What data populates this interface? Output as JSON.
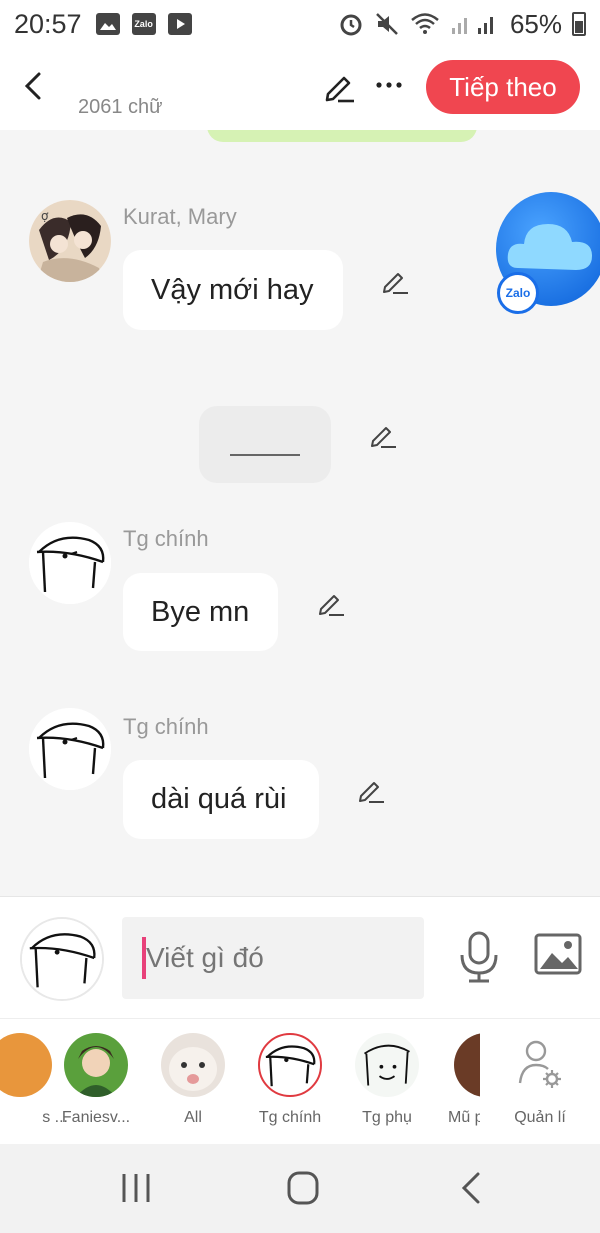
{
  "status": {
    "time": "20:57",
    "battery": "65%",
    "app_icons": [
      "gallery-icon",
      "zalo-icon",
      "play-icon"
    ],
    "right_icons": [
      "alarm-icon",
      "mute-icon",
      "wifi-icon",
      "signal-icon"
    ]
  },
  "header": {
    "word_count": "2061 chữ",
    "next_label": "Tiếp theo"
  },
  "messages": [
    {
      "sender": "Kurat, Mary",
      "text": "Vậy mới hay",
      "avatar": "anime-couple"
    },
    {
      "sender": "",
      "text": "____",
      "avatar": ""
    },
    {
      "sender": "Tg chính",
      "text": "Bye mn",
      "avatar": "sketch-face"
    },
    {
      "sender": "Tg chính",
      "text": "dài quá rùi",
      "avatar": "sketch-face"
    }
  ],
  "floating": {
    "badge": "Zalo"
  },
  "composer": {
    "placeholder": "Viết gì đó"
  },
  "characters": [
    {
      "name": "s ...",
      "selected": false
    },
    {
      "name": "Faniesv...",
      "selected": false
    },
    {
      "name": "All",
      "selected": false
    },
    {
      "name": "Tg chính",
      "selected": true
    },
    {
      "name": "Tg phụ",
      "selected": false
    },
    {
      "name": "Mũ p",
      "selected": false
    },
    {
      "name": "Quản lí",
      "selected": false
    }
  ],
  "colors": {
    "accent": "#f04650",
    "selected_ring": "#e03a40",
    "caret": "#e8417a",
    "background": "#f5f5f5"
  }
}
